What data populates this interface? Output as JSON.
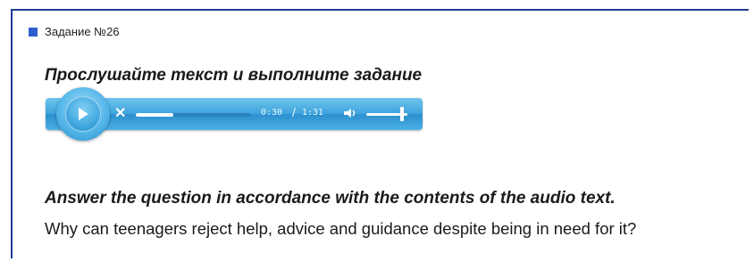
{
  "task": {
    "label": "Задание №26"
  },
  "instruction": "Прослушайте текст и выполните задание",
  "player": {
    "current_time": "0:30",
    "separator": "/",
    "total_time": "1:31",
    "progress_fraction": 0.33,
    "volume_fraction": 0.85,
    "accent_color": "#3ea3dc"
  },
  "question": {
    "title": "Answer the question in accordance with the contents of the audio text.",
    "text": "Why can teenagers reject help, advice and guidance despite being in need for it?"
  }
}
